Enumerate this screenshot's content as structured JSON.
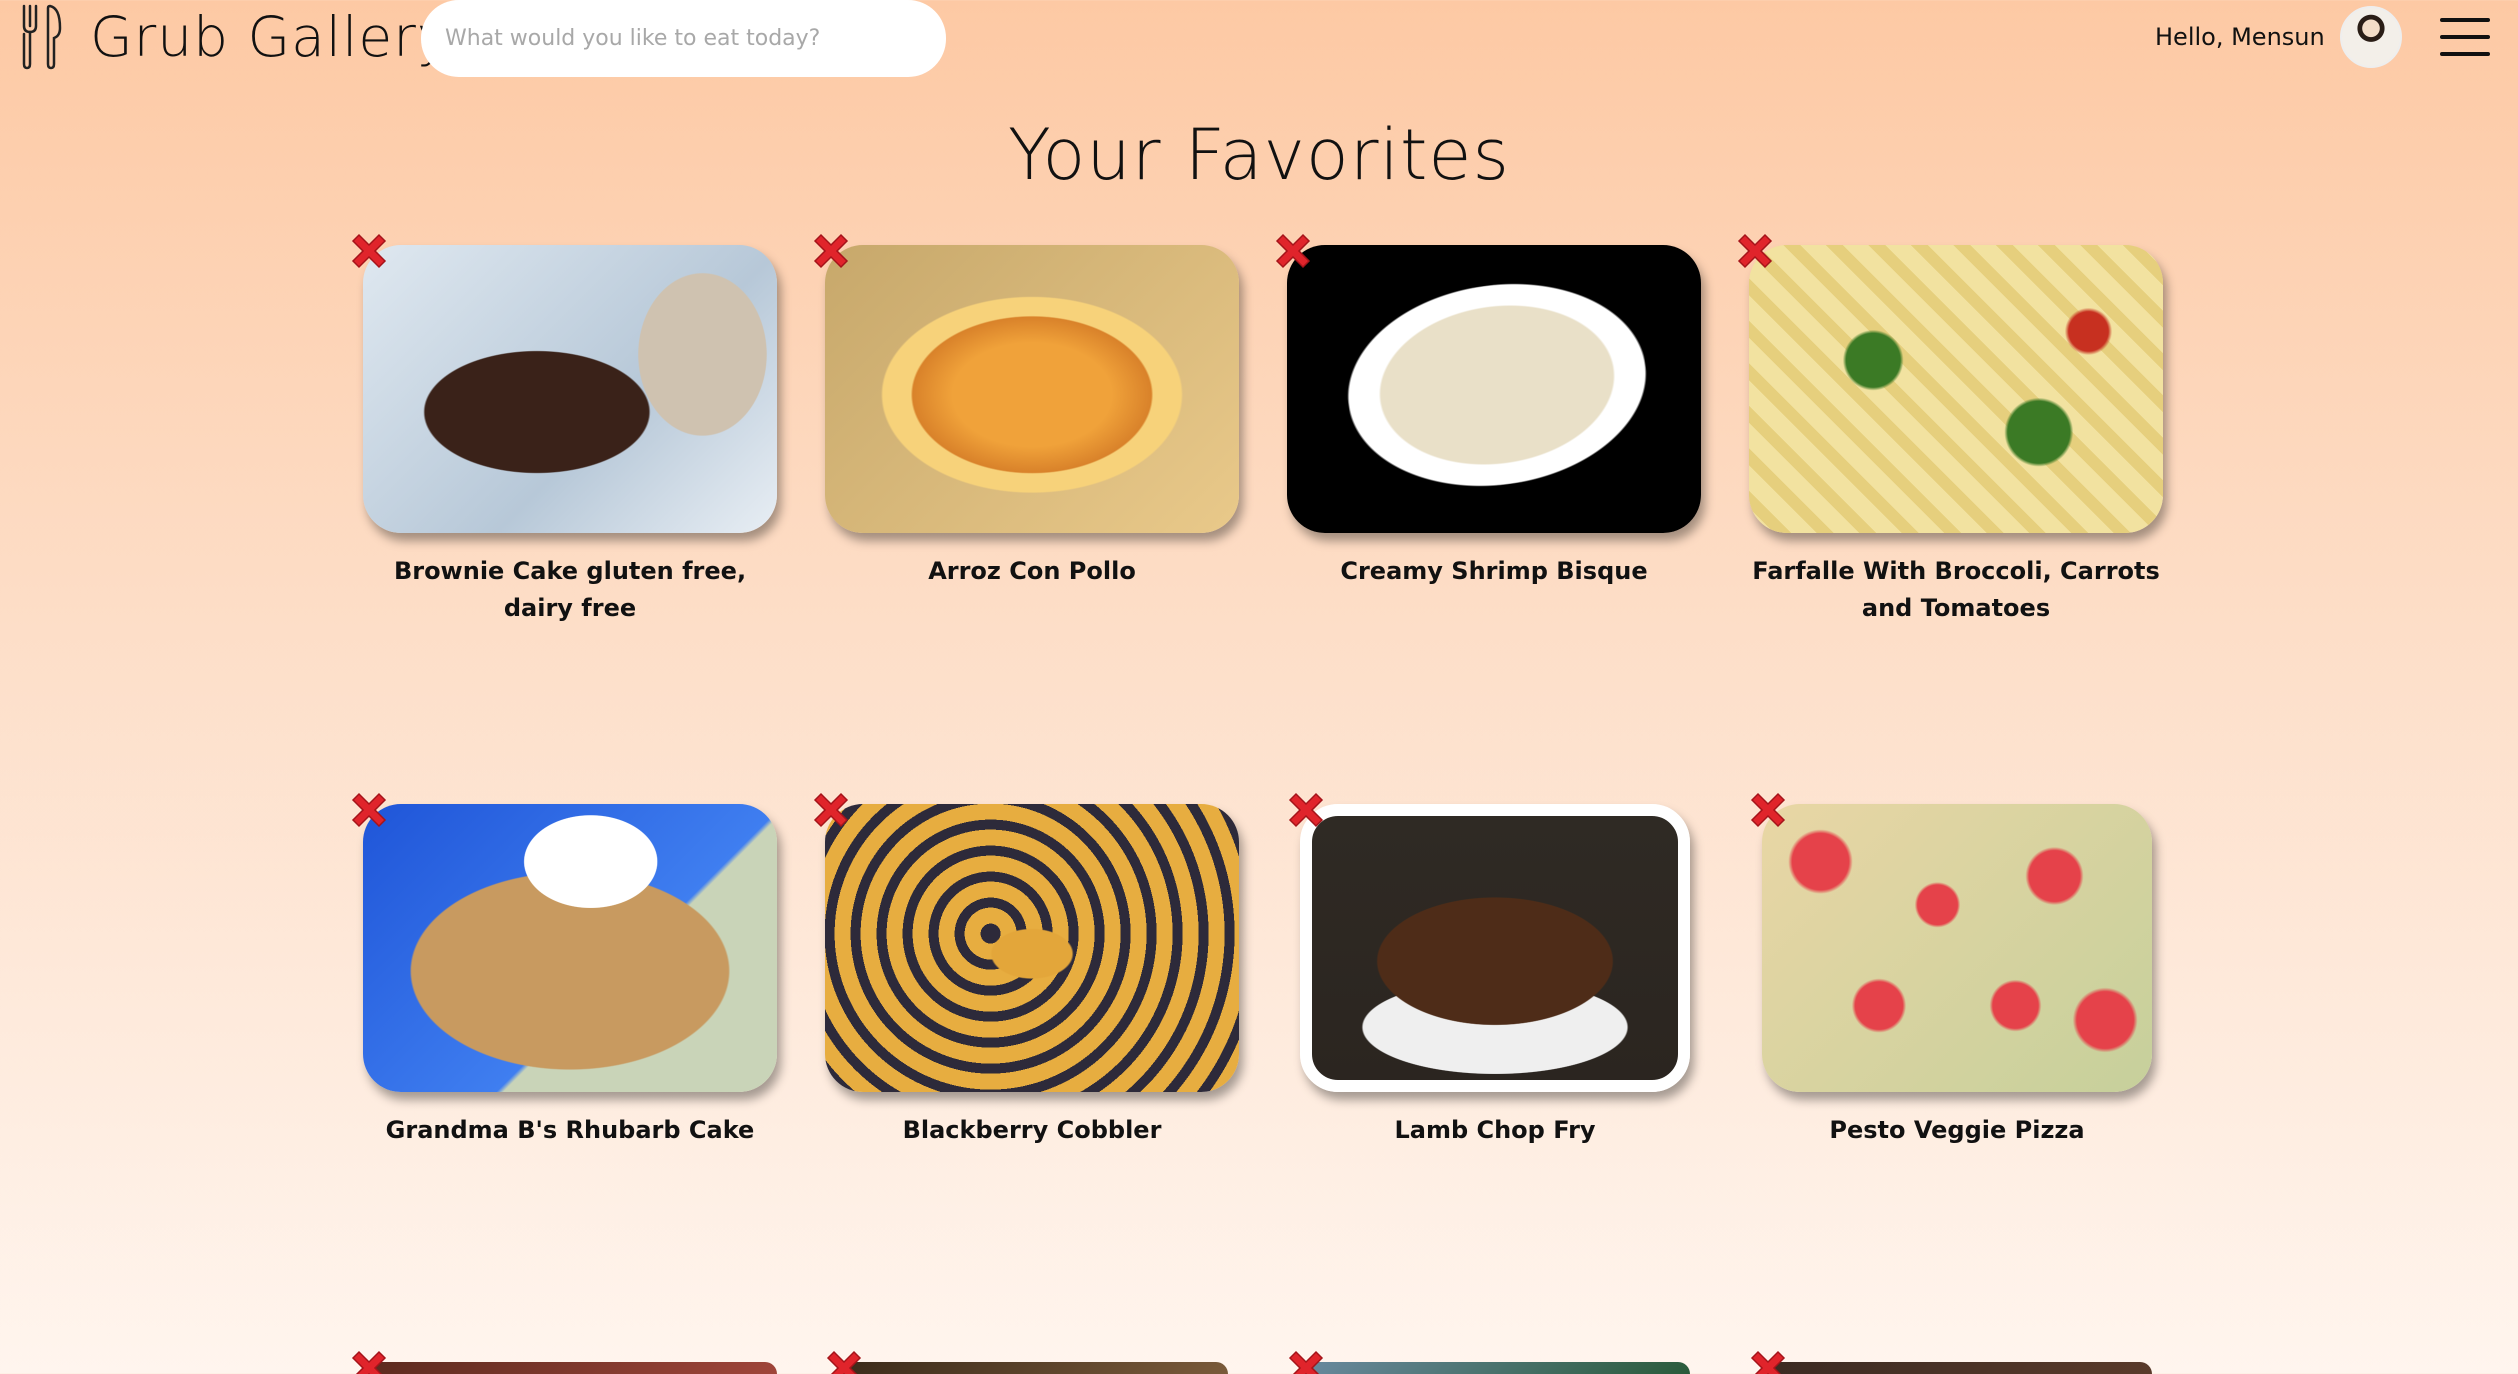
{
  "header": {
    "brand": "Grub Gallery",
    "search_placeholder": "What would you like to eat today?",
    "greeting": "Hello, Mensun"
  },
  "page_title": "Your Favorites",
  "favorites": [
    {
      "label": "Brownie Cake gluten free, dairy free"
    },
    {
      "label": "Arroz Con Pollo"
    },
    {
      "label": "Creamy Shrimp Bisque"
    },
    {
      "label": "Farfalle With Broccoli, Carrots and Tomatoes"
    },
    {
      "label": "Grandma B's Rhubarb Cake"
    },
    {
      "label": "Blackberry Cobbler"
    },
    {
      "label": "Lamb Chop Fry"
    },
    {
      "label": "Pesto Veggie Pizza"
    },
    {
      "label": ""
    },
    {
      "label": ""
    },
    {
      "label": ""
    },
    {
      "label": ""
    }
  ],
  "colors": {
    "background_top": "#fdc9a4",
    "background_bottom": "#fff5ee",
    "remove_red": "#e0242b"
  }
}
